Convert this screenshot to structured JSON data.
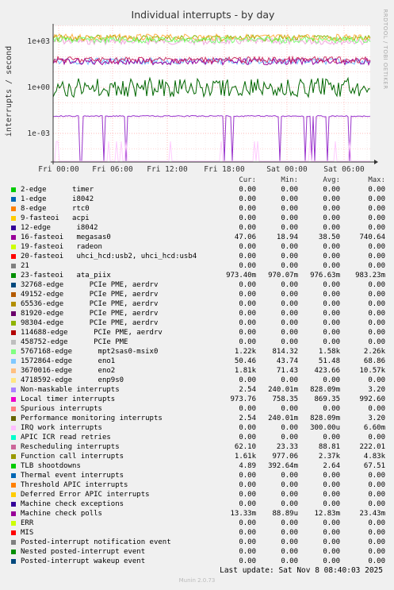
{
  "chart_data": {
    "type": "line",
    "title": "Individual interrupts - by day",
    "ylabel": "interrupts / second",
    "y_scale": "log",
    "y_ticks": [
      {
        "value": 1000,
        "label": "1e+03"
      },
      {
        "value": 1,
        "label": "1e+00"
      },
      {
        "value": 0.001,
        "label": "1e-03"
      }
    ],
    "x_ticks": [
      "Fri 00:00",
      "Fri 06:00",
      "Fri 12:00",
      "Fri 18:00",
      "Sat 00:00",
      "Sat 06:00"
    ],
    "grid": true,
    "background": "#ffffff",
    "series_summary": [
      {
        "name": "Local timer interrupts",
        "color": "#f1a9e0",
        "approx": 973
      },
      {
        "name": "Function call interrupts",
        "color": "#8db300",
        "approx": 1610
      },
      {
        "name": "3670016-edge enp9s0",
        "color": "#ffb24a",
        "approx": 1810
      },
      {
        "name": "5767168-edge mpt2sas0-msix0",
        "color": "#7dff7a",
        "approx": 1220
      },
      {
        "name": "1572864-edge eno1",
        "color": "#6fb7ff",
        "approx": 50.46
      },
      {
        "name": "16-fasteoi megasas0",
        "color": "#990099",
        "approx": 47.06
      },
      {
        "name": "Rescheduling interrupts",
        "color": "#cc3366",
        "approx": 62.1
      },
      {
        "name": "Machine check polls",
        "color": "#9933cc",
        "approx": 0.01333
      },
      {
        "name": "23-fasteoi ata_piix",
        "color": "#006600",
        "approx": 0.9734
      },
      {
        "name": "IRQ work interrupts",
        "color": "#ffccff",
        "approx": 0.0003
      }
    ]
  },
  "side_label": "RRDTOOL / TOBI OETIKER",
  "legend": {
    "headers": [
      "Cur:",
      "Min:",
      "Avg:",
      "Max:"
    ],
    "rows": [
      {
        "name": "2-edge      timer",
        "color": "#00cc00",
        "cur": "0.00",
        "min": "0.00",
        "avg": "0.00",
        "max": "0.00"
      },
      {
        "name": "1-edge      i8042",
        "color": "#0066b3",
        "cur": "0.00",
        "min": "0.00",
        "avg": "0.00",
        "max": "0.00"
      },
      {
        "name": "8-edge      rtc0",
        "color": "#ff8000",
        "cur": "0.00",
        "min": "0.00",
        "avg": "0.00",
        "max": "0.00"
      },
      {
        "name": "9-fasteoi   acpi",
        "color": "#ffcc00",
        "cur": "0.00",
        "min": "0.00",
        "avg": "0.00",
        "max": "0.00"
      },
      {
        "name": "12-edge      i8042",
        "color": "#330099",
        "cur": "0.00",
        "min": "0.00",
        "avg": "0.00",
        "max": "0.00"
      },
      {
        "name": "16-fasteoi   megasas0",
        "color": "#990099",
        "cur": "47.06",
        "min": "18.94",
        "avg": "38.50",
        "max": "740.64"
      },
      {
        "name": "19-fasteoi   radeon",
        "color": "#ccff00",
        "cur": "0.00",
        "min": "0.00",
        "avg": "0.00",
        "max": "0.00"
      },
      {
        "name": "20-fasteoi   uhci_hcd:usb2, uhci_hcd:usb4",
        "color": "#ff0000",
        "cur": "0.00",
        "min": "0.00",
        "avg": "0.00",
        "max": "0.00"
      },
      {
        "name": "21",
        "color": "#808080",
        "cur": "0.00",
        "min": "0.00",
        "avg": "0.00",
        "max": "0.00"
      },
      {
        "name": "23-fasteoi   ata_piix",
        "color": "#008f00",
        "cur": "973.40m",
        "min": "970.07m",
        "avg": "976.63m",
        "max": "983.23m"
      },
      {
        "name": "32768-edge      PCIe PME, aerdrv",
        "color": "#00487d",
        "cur": "0.00",
        "min": "0.00",
        "avg": "0.00",
        "max": "0.00"
      },
      {
        "name": "49152-edge      PCIe PME, aerdrv",
        "color": "#b35a00",
        "cur": "0.00",
        "min": "0.00",
        "avg": "0.00",
        "max": "0.00"
      },
      {
        "name": "65536-edge      PCIe PME, aerdrv",
        "color": "#b38f00",
        "cur": "0.00",
        "min": "0.00",
        "avg": "0.00",
        "max": "0.00"
      },
      {
        "name": "81920-edge      PCIe PME, aerdrv",
        "color": "#6b006b",
        "cur": "0.00",
        "min": "0.00",
        "avg": "0.00",
        "max": "0.00"
      },
      {
        "name": "98304-edge      PCIe PME, aerdrv",
        "color": "#8fb300",
        "cur": "0.00",
        "min": "0.00",
        "avg": "0.00",
        "max": "0.00"
      },
      {
        "name": "114688-edge      PCIe PME, aerdrv",
        "color": "#b30000",
        "cur": "0.00",
        "min": "0.00",
        "avg": "0.00",
        "max": "0.00"
      },
      {
        "name": "458752-edge      PCIe PME",
        "color": "#bebebe",
        "cur": "0.00",
        "min": "0.00",
        "avg": "0.00",
        "max": "0.00"
      },
      {
        "name": "5767168-edge      mpt2sas0-msix0",
        "color": "#80ff80",
        "cur": "1.22k",
        "min": "814.32",
        "avg": "1.58k",
        "max": "2.26k"
      },
      {
        "name": "1572864-edge      eno1",
        "color": "#80c9ff",
        "cur": "50.46",
        "min": "43.74",
        "avg": "51.48",
        "max": "68.86"
      },
      {
        "name": "3670016-edge      eno2",
        "color": "#ffc080",
        "cur": "1.81k",
        "min": "71.43",
        "avg": "423.66",
        "max": "10.57k"
      },
      {
        "name": "4718592-edge      enp9s0",
        "color": "#ffe680",
        "cur": "0.00",
        "min": "0.00",
        "avg": "0.00",
        "max": "0.00"
      },
      {
        "name": "Non-maskable interrupts",
        "color": "#aa80ff",
        "cur": "2.54",
        "min": "240.01m",
        "avg": "828.09m",
        "max": "3.20"
      },
      {
        "name": "Local timer interrupts",
        "color": "#ee00cc",
        "cur": "973.76",
        "min": "758.35",
        "avg": "869.35",
        "max": "992.60"
      },
      {
        "name": "Spurious interrupts",
        "color": "#ff8080",
        "cur": "0.00",
        "min": "0.00",
        "avg": "0.00",
        "max": "0.00"
      },
      {
        "name": "Performance monitoring interrupts",
        "color": "#666600",
        "cur": "2.54",
        "min": "240.01m",
        "avg": "828.09m",
        "max": "3.20"
      },
      {
        "name": "IRQ work interrupts",
        "color": "#ffbfff",
        "cur": "0.00",
        "min": "0.00",
        "avg": "300.00u",
        "max": "6.60m"
      },
      {
        "name": "APIC ICR read retries",
        "color": "#00ffcc",
        "cur": "0.00",
        "min": "0.00",
        "avg": "0.00",
        "max": "0.00"
      },
      {
        "name": "Rescheduling interrupts",
        "color": "#cc6699",
        "cur": "62.10",
        "min": "23.33",
        "avg": "88.81",
        "max": "222.01"
      },
      {
        "name": "Function call interrupts",
        "color": "#999900",
        "cur": "1.61k",
        "min": "977.06",
        "avg": "2.37k",
        "max": "4.83k"
      },
      {
        "name": "TLB shootdowns",
        "color": "#00cc00",
        "cur": "4.89",
        "min": "392.64m",
        "avg": "2.64",
        "max": "67.51"
      },
      {
        "name": "Thermal event interrupts",
        "color": "#0066b3",
        "cur": "0.00",
        "min": "0.00",
        "avg": "0.00",
        "max": "0.00"
      },
      {
        "name": "Threshold APIC interrupts",
        "color": "#ff8000",
        "cur": "0.00",
        "min": "0.00",
        "avg": "0.00",
        "max": "0.00"
      },
      {
        "name": "Deferred Error APIC interrupts",
        "color": "#ffcc00",
        "cur": "0.00",
        "min": "0.00",
        "avg": "0.00",
        "max": "0.00"
      },
      {
        "name": "Machine check exceptions",
        "color": "#330099",
        "cur": "0.00",
        "min": "0.00",
        "avg": "0.00",
        "max": "0.00"
      },
      {
        "name": "Machine check polls",
        "color": "#990099",
        "cur": "13.33m",
        "min": "88.89u",
        "avg": "12.83m",
        "max": "23.43m"
      },
      {
        "name": "ERR",
        "color": "#ccff00",
        "cur": "0.00",
        "min": "0.00",
        "avg": "0.00",
        "max": "0.00"
      },
      {
        "name": "MIS",
        "color": "#ff0000",
        "cur": "0.00",
        "min": "0.00",
        "avg": "0.00",
        "max": "0.00"
      },
      {
        "name": "Posted-interrupt notification event",
        "color": "#808080",
        "cur": "0.00",
        "min": "0.00",
        "avg": "0.00",
        "max": "0.00"
      },
      {
        "name": "Nested posted-interrupt event",
        "color": "#008f00",
        "cur": "0.00",
        "min": "0.00",
        "avg": "0.00",
        "max": "0.00"
      },
      {
        "name": "Posted-interrupt wakeup event",
        "color": "#00487d",
        "cur": "0.00",
        "min": "0.00",
        "avg": "0.00",
        "max": "0.00"
      }
    ]
  },
  "last_update": "Last update: Sat Nov  8 08:40:03 2025",
  "munin_version": "Munin 2.0.73"
}
